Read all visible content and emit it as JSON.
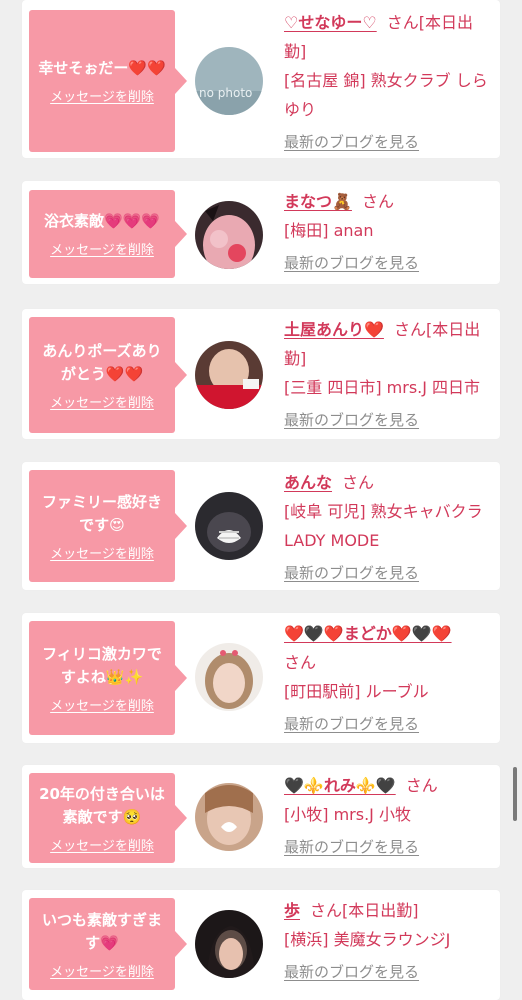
{
  "delete_label": "メッセージを削除",
  "blog_label": "最新のブログを見る",
  "san_suffix": "さん",
  "colors": {
    "bubble": "#f799a6",
    "name": "#d2395a",
    "muted": "#8d8d8d"
  },
  "cards": [
    {
      "message": "幸せそぉだー❤️❤️",
      "name": "♡せなゆー♡",
      "tag": "[本日出勤]",
      "shop": "[名古屋 錦] 熟女クラブ しらゆり",
      "avatar_text": "no photo"
    },
    {
      "message": "浴衣素敵💗💗💗",
      "name": "まなつ🧸",
      "tag": "",
      "shop": "[梅田] anan"
    },
    {
      "message": "あんりポーズありがとう❤️❤️",
      "name": "土屋あんり❤️",
      "tag": "[本日出勤]",
      "shop": "[三重 四日市] mrs.J 四日市"
    },
    {
      "message": "ファミリー感好きです😍",
      "name": "あんな",
      "tag": "",
      "shop": "[岐阜 可児] 熟女キャバクラ LADY MODE"
    },
    {
      "message": "フィリコ激カワですよね👑✨",
      "name": "❤️🖤❤️まどか❤️🖤❤️",
      "tag": "",
      "shop": "[町田駅前] ルーブル"
    },
    {
      "message": "20年の付き合いは素敵です🥺",
      "name": "🖤⚜️れみ⚜️🖤",
      "tag": "",
      "shop": "[小牧] mrs.J 小牧"
    },
    {
      "message": "いつも素敵すぎます💗",
      "name": "歩",
      "tag": "[本日出勤]",
      "shop": "[横浜] 美魔女ラウンジJ"
    }
  ]
}
